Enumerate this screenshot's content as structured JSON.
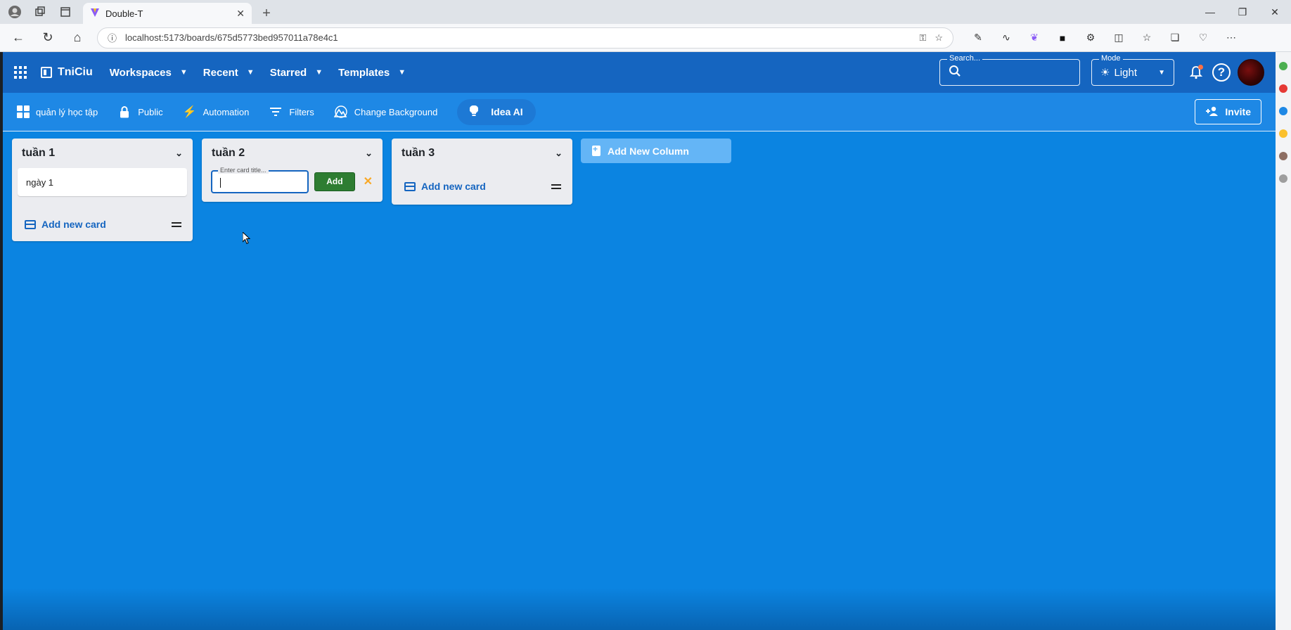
{
  "browser": {
    "tab_title": "Double-T",
    "url": "localhost:5173/boards/675d5773bed957011a78e4c1",
    "accent_color": "#8b5cf6"
  },
  "appbar": {
    "brand": "TniCiu",
    "menus": [
      "Workspaces",
      "Recent",
      "Starred",
      "Templates"
    ],
    "search": {
      "label": "Search...",
      "value": ""
    },
    "mode": {
      "label": "Mode",
      "value": "Light"
    }
  },
  "boardbar": {
    "board_name": "quản lý học tập",
    "visibility": "Public",
    "automation": "Automation",
    "filters": "Filters",
    "change_background": "Change Background",
    "idea_ai": "Idea AI",
    "invite": "Invite"
  },
  "columns": [
    {
      "title": "tuần 1",
      "cards": [
        "ngày 1"
      ],
      "add_card_label": "Add new card"
    },
    {
      "title": "tuần 2",
      "cards": [],
      "add_form": {
        "placeholder": "Enter card title...",
        "add_label": "Add"
      }
    },
    {
      "title": "tuần 3",
      "cards": [],
      "add_card_label": "Add new card"
    }
  ],
  "add_column_label": "Add New Column",
  "colors": {
    "appbar": "#1565c0",
    "board_bg": "#0b84e1",
    "add_button": "#2e7d32",
    "cancel_icon": "#f9a825"
  }
}
